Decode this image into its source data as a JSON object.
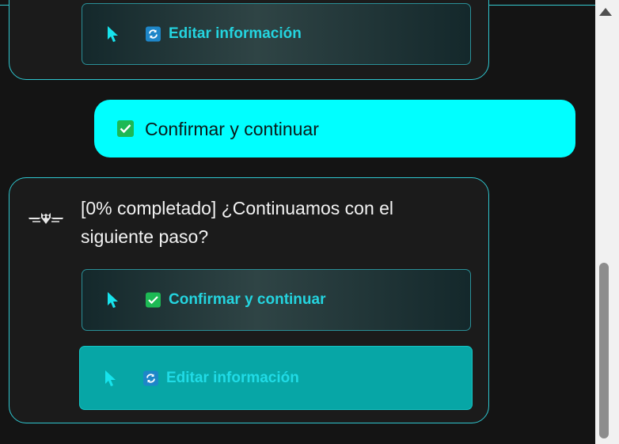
{
  "top_card": {
    "edit_option": {
      "icon": "sync-icon",
      "label": "Editar información"
    }
  },
  "user_message": {
    "icon": "checkmark-icon",
    "text": "Confirmar y continuar"
  },
  "bot_message": {
    "avatar": "owl-logo",
    "text": "[0% completado] ¿Continuamos con el siguiente paso?",
    "options": [
      {
        "icon": "checkmark-icon",
        "label": "Confirmar y continuar",
        "state": "default"
      },
      {
        "icon": "sync-icon",
        "label": "Editar información",
        "state": "hover"
      }
    ]
  },
  "colors": {
    "accent": "#00ffff",
    "card_border": "#2fc6cf",
    "option_text": "#24d4df",
    "active_option_bg": "#07a6a6",
    "background": "#141414"
  }
}
